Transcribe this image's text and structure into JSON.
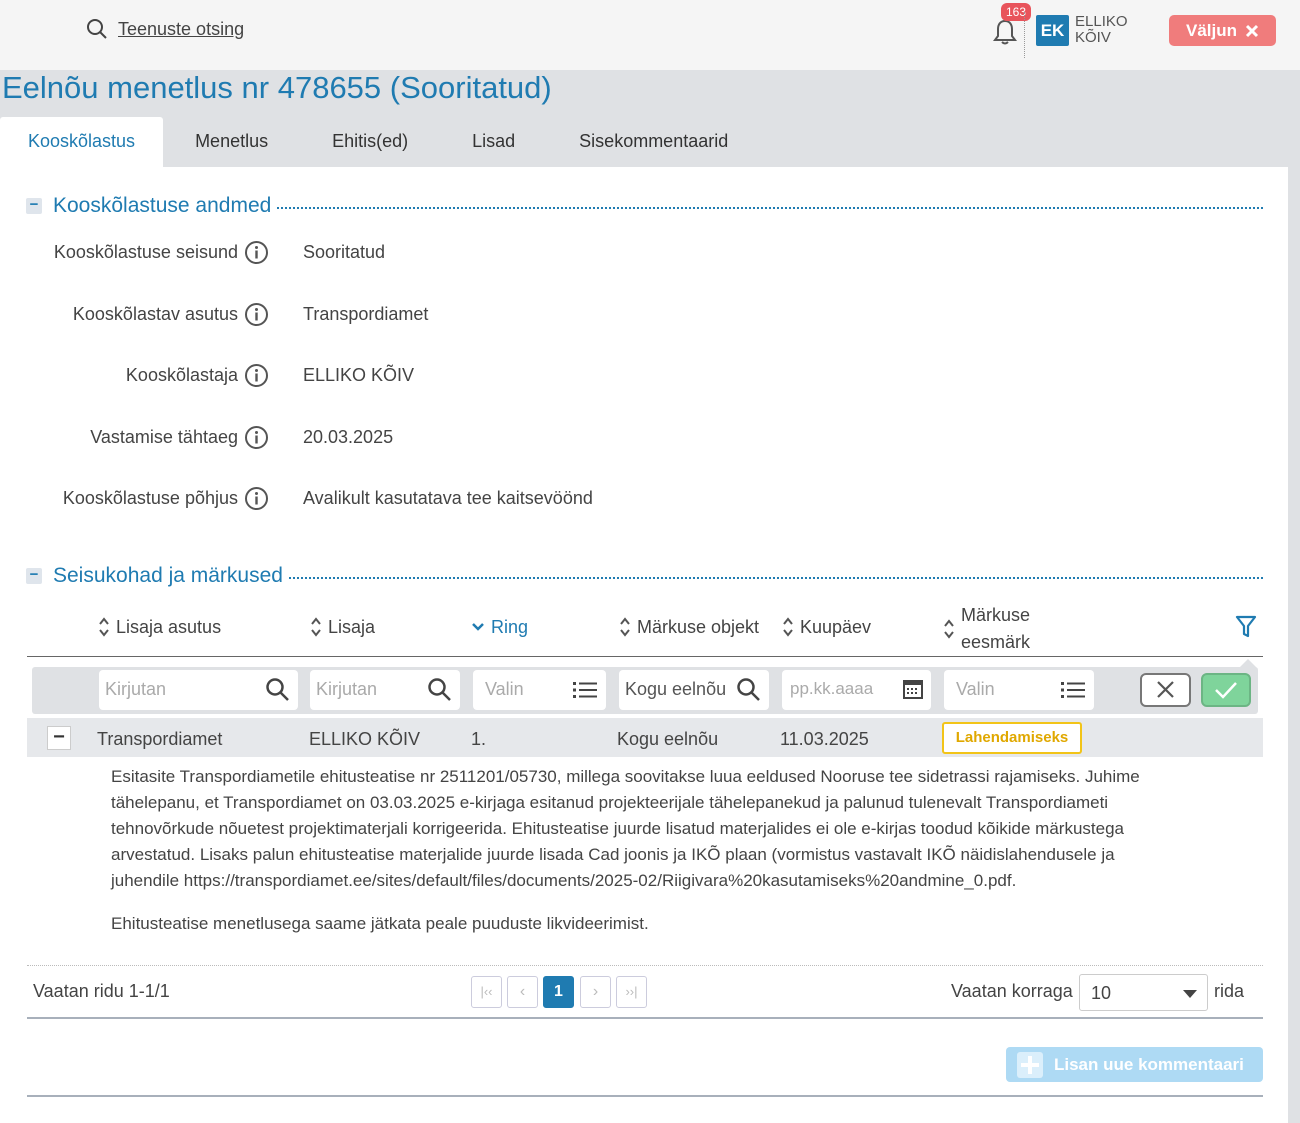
{
  "header": {
    "search_label": "Teenuste otsing",
    "notifications_count": "163",
    "user_initials": "EK",
    "user_first": "ELLIKO",
    "user_last": "KÕIV",
    "logout_label": "Väljun"
  },
  "page": {
    "title": "Eelnõu menetlus nr 478655 (Sooritatud)"
  },
  "tabs": [
    {
      "label": "Kooskõlastus",
      "active": true
    },
    {
      "label": "Menetlus",
      "active": false
    },
    {
      "label": "Ehitis(ed)",
      "active": false
    },
    {
      "label": "Lisad",
      "active": false
    },
    {
      "label": "Sisekommentaarid",
      "active": false
    }
  ],
  "details": {
    "section_title": "Kooskõlastuse andmed",
    "fields": [
      {
        "label": "Kooskõlastuse seisund",
        "value": "Sooritatud"
      },
      {
        "label": "Kooskõlastav asutus",
        "value": "Transpordiamet"
      },
      {
        "label": "Kooskõlastaja",
        "value": "ELLIKO KÕIV"
      },
      {
        "label": "Vastamise tähtaeg",
        "value": "20.03.2025"
      },
      {
        "label": "Kooskõlastuse põhjus",
        "value": "Avalikult kasutatava tee kaitsevöönd"
      }
    ]
  },
  "remarks": {
    "section_title": "Seisukohad ja märkused",
    "columns": [
      "Lisaja asutus",
      "Lisaja",
      "Ring",
      "Märkuse objekt",
      "Kuupäev",
      "Märkuse",
      "eesmärk"
    ],
    "filters": {
      "agency_placeholder": "Kirjutan",
      "author_placeholder": "Kirjutan",
      "round_placeholder": "Valin",
      "object_value": "Kogu eelnõu",
      "date_placeholder": "pp.kk.aaaa",
      "purpose_placeholder": "Valin"
    },
    "row": {
      "agency": "Transpordiamet",
      "author": "ELLIKO KÕIV",
      "round": "1.",
      "object": "Kogu eelnõu",
      "date": "11.03.2025",
      "purpose": "Lahendamiseks"
    },
    "comment_p1_l1": "Esitasite Transpordiametile ehitusteatise nr 2511201/05730, millega soovitakse luua eeldused Nooruse tee sidetrassi rajamiseks. Juhime",
    "comment_p1_l2": "tähelepanu, et Transpordiamet on 03.03.2025 e-kirjaga esitanud projekteerijale tähelepanekud ja palunud tulenevalt Transpordiameti",
    "comment_p1_l3": "tehnovõrkude nõuetest projektimaterjali korrigeerida. Ehitusteatise juurde lisatud materjalides ei ole e-kirjas toodud kõikide märkustega",
    "comment_p1_l4": "arvestatud. Lisaks palun ehitusteatise materjalide juurde lisada Cad joonis ja IKÕ plaan (vormistus vastavalt IKÕ näidislahendusele ja",
    "comment_p1_l5": "juhendile https://transpordiamet.ee/sites/default/files/documents/2025-02/Riigivara%20kasutamiseks%20andmine_0.pdf.",
    "comment_p2": "Ehitusteatise menetlusega saame jätkata peale puuduste likvideerimist.",
    "pager": {
      "info": "Vaatan ridu 1-1/1",
      "first": "|‹‹",
      "prev": "‹",
      "current": "1",
      "next": "›",
      "last": "››|",
      "size_label": "Vaatan korraga",
      "size_value": "10",
      "size_suffix": "rida"
    },
    "add_comment_label": "Lisan uue kommentaari"
  },
  "colors": {
    "accent": "#1f7bb1",
    "logout": "#f07c7c",
    "badge": "#e8545b",
    "status_yellow": "#f2c418"
  }
}
